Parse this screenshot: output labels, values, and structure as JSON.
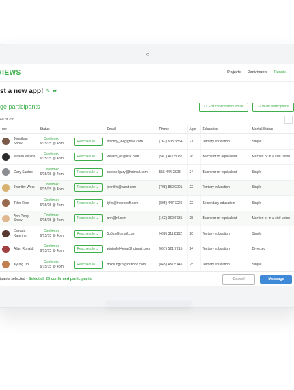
{
  "device": {
    "top_icon": "«"
  },
  "app": {
    "logo": "VIEWS",
    "nav": {
      "projects": "Projects",
      "participants": "Participants",
      "user": "Dennis ⌄"
    },
    "title": "st a new app!",
    "title_icons": [
      "edit-icon",
      "share-icon"
    ],
    "section_title": "ge participants",
    "buttons": {
      "edit_confirmation": "☐ Edit confirmation email",
      "invite": "☑ Invite participants"
    },
    "count": "40 of 256",
    "columns": [
      "me",
      "Status",
      "Email",
      "Phone",
      "Age",
      "Education",
      "Marital Status"
    ],
    "rows": [
      {
        "name": "Jonathan Snow",
        "status": "Confirmed",
        "date": "6/15/15 @ 4pm",
        "action": "Reschedule ⌄",
        "email": "timothy_99@gmail.com",
        "phone": "(762) 633 3854",
        "age": "21",
        "education": "Tertiary education",
        "marital": "Single",
        "avatar_color": "#7a5a48"
      },
      {
        "name": "Mason Wilson",
        "status": "Confirmed",
        "date": "6/15/15 @ 4pm",
        "action": "Reschedule ⌄",
        "email": "william_8s@esc.com",
        "phone": "(581) 417 5087",
        "age": "26",
        "education": "Bachelor or equivalent",
        "marital": "Married or in a civil union",
        "avatar_color": "#2b2b2b"
      },
      {
        "name": "Gary Santos",
        "status": "Confirmed",
        "date": "6/15/15 @ 4pm",
        "action": "Reschedule ⌄",
        "email": "santos4gary@hotmail.com",
        "phone": "555-444-2828",
        "age": "24",
        "education": "Bachelor or equivalent",
        "marital": "Single",
        "avatar_color": "#8a8e93"
      },
      {
        "name": "Jennifer West",
        "status": "Confirmed",
        "date": "6/15/15 @ 4pm",
        "action": "Reschedule ⌄",
        "email": "jennifer@west.com",
        "phone": "(708) 850 9201",
        "age": "22",
        "education": "Tertiary education",
        "marital": "Single",
        "avatar_color": "#d8b070"
      },
      {
        "name": "Tyler Rice",
        "status": "Confirmed",
        "date": "6/15/15 @ 4pm",
        "action": "Reschedule ⌄",
        "email": "tyler@intercooft.com",
        "phone": "(805) 447 7226",
        "age": "22",
        "education": "Secondary education",
        "marital": "Single",
        "avatar_color": "#9a6a50"
      },
      {
        "name": "Ann Perry Snow",
        "status": "Confirmed",
        "date": "6/15/15 @ 4pm",
        "action": "Reschedule ⌄",
        "email": "ann@rfl.com",
        "phone": "(162) 960 6735",
        "age": "25",
        "education": "Bachelor or equivalent",
        "marital": "Married or in a civil union",
        "avatar_color": "#e0b890"
      },
      {
        "name": "Estrada Katerine",
        "status": "Confirmed",
        "date": "6/15/15 @ 4pm",
        "action": "Reschedule ⌄",
        "email": "5o5vs@gmail.com",
        "phone": "(498) 311 8102",
        "age": "20",
        "education": "Tertiary education",
        "marital": "Single",
        "avatar_color": "#5a3a30"
      },
      {
        "name": "Allan Ronald",
        "status": "Confirmed",
        "date": "6/15/15 @ 4pm",
        "action": "Reschedule ⌄",
        "email": "winterfell4eva@hotmail.com",
        "phone": "(691) 521 7715",
        "age": "24",
        "education": "Tertiary education",
        "marital": "Divorced",
        "avatar_color": "#a04040"
      },
      {
        "name": "Xyung Do",
        "status": "Confirmed",
        "date": "6/15/15 @ 4pm",
        "action": "Reschedule ⌄",
        "email": "doxyung13@outlook.com",
        "phone": "(845) 451 5145",
        "age": "25",
        "education": "Tertiary education",
        "marital": "Single",
        "avatar_color": "#c08050"
      }
    ],
    "footer": {
      "selected": "ipants selected - ",
      "select_all": "Select all 25 confirmed participants",
      "cancel": "Cancel",
      "message": "Message"
    }
  }
}
